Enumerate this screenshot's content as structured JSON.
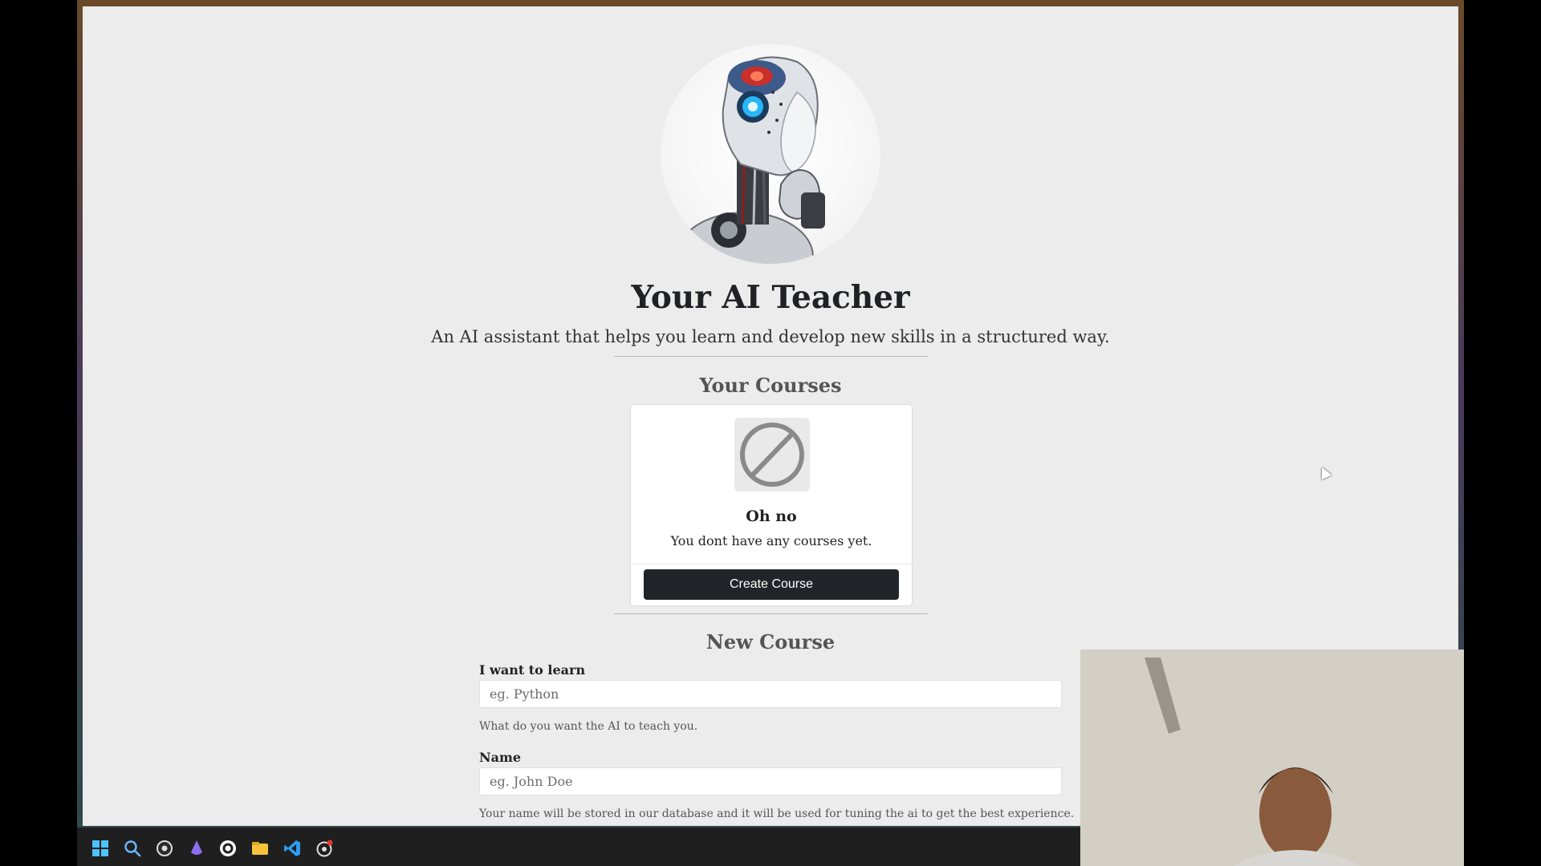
{
  "header": {
    "title": "Your AI Teacher",
    "subtitle": "An AI assistant that helps you learn and develop new skills in a structured way."
  },
  "courses": {
    "section_title": "Your Courses",
    "empty_title": "Oh no",
    "empty_message": "You dont have any courses yet.",
    "create_button_label": "Create Course"
  },
  "new_course": {
    "section_title": "New Course",
    "learn_label": "I want to learn",
    "learn_placeholder": "eg. Python",
    "learn_help": "What do you want the AI to teach you.",
    "name_label": "Name",
    "name_placeholder": "eg. John Doe",
    "name_help": "Your name will be stored in our database and it will be used for tuning the ai to get the best experience."
  },
  "taskbar": {
    "icons": [
      "windows-start-icon",
      "search-icon",
      "obs-icon",
      "app-purple-icon",
      "ubisoft-icon",
      "file-explorer-icon",
      "vscode-icon",
      "recording-app-icon"
    ]
  },
  "colors": {
    "page_background": "#ececec",
    "button_background": "#212529",
    "card_background": "#ffffff",
    "taskbar_background": "#1f1f1f"
  }
}
